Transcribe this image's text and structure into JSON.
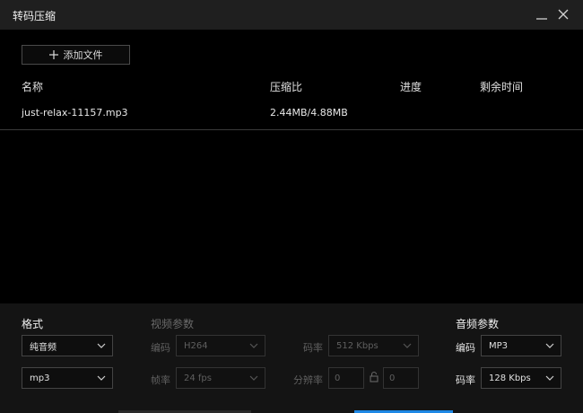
{
  "window": {
    "title": "转码压缩"
  },
  "toolbar": {
    "add_file_label": "添加文件"
  },
  "table": {
    "columns": [
      "名称",
      "压缩比",
      "进度",
      "剩余时间"
    ],
    "rows": [
      {
        "name": "just-relax-11157.mp3",
        "ratio": "2.44MB/4.88MB",
        "progress": "",
        "remaining": ""
      }
    ]
  },
  "format": {
    "heading": "格式",
    "type_value": "纯音频",
    "container_value": "mp3"
  },
  "video_params": {
    "heading": "视频参数",
    "codec_label": "编码",
    "codec_value": "H264",
    "bitrate_label": "码率",
    "bitrate_value": "512 Kbps",
    "fps_label": "帧率",
    "fps_value": "24 fps",
    "resolution_label": "分辨率",
    "width_value": "0",
    "height_value": "0"
  },
  "audio_params": {
    "heading": "音频参数",
    "codec_label": "编码",
    "codec_value": "MP3",
    "bitrate_label": "码率",
    "bitrate_value": "128 Kbps"
  },
  "colors": {
    "accent": "#1e88e5",
    "background": "#000000",
    "panel": "#141414",
    "titlebar": "#1f1f1f"
  }
}
